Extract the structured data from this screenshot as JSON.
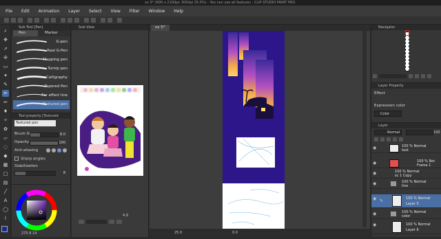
{
  "window": {
    "title": "xx 5* (600 x 2100px 300dpi 25.0%)  - You can use all features - CLIP STUDIO PAINT PRO"
  },
  "menu": {
    "items": [
      "File",
      "Edit",
      "Animation",
      "Layer",
      "Select",
      "View",
      "Filter",
      "Window",
      "Help"
    ]
  },
  "subtool": {
    "panel_title": "Sub Tool [Pen]",
    "tabs": [
      "Pen",
      "Marker"
    ],
    "brushes": [
      {
        "name": "G-pen"
      },
      {
        "name": "Real G-Pen"
      },
      {
        "name": "Mapping pen"
      },
      {
        "name": "Turnip pen"
      },
      {
        "name": "Calligraphy"
      },
      {
        "name": "Tapered Pen"
      },
      {
        "name": "For effect line"
      },
      {
        "name": "Textured pen"
      }
    ],
    "selected": "Textured pen"
  },
  "toolprop": {
    "panel_title": "Tool property [Textured",
    "preset_name": "Textured pen",
    "brush_size": {
      "label": "Brush Size",
      "value": "8.0",
      "fraction": 0.35
    },
    "opacity": {
      "label": "Opacity",
      "value": "100",
      "fraction": 1.0
    },
    "anti_aliasing": {
      "label": "Anti-aliasing"
    },
    "sharp_angles": {
      "label": "Sharp angles"
    },
    "stabilization": {
      "label": "Stabilization",
      "value": "8",
      "fraction": 0.25
    }
  },
  "color": {
    "main": "#1a2a8a",
    "sub": "#ffffff",
    "readout": "275  8  14"
  },
  "subview": {
    "panel_title": "Sub View"
  },
  "canvas": {
    "tab_label": "xx 5*",
    "zoom": "25.0",
    "angle": "0.0",
    "status_left": "4.9"
  },
  "navigator": {
    "panel_title": "Navigator"
  },
  "layerprop": {
    "panel_title": "Layer Property",
    "effect_label": "Effect",
    "expression_label": "Expression color",
    "expression_value": "Color"
  },
  "layers": {
    "panel_title": "Layer",
    "blend_mode": "Normal",
    "opacity": "100",
    "items": [
      {
        "line1": "100 % Normal",
        "line2": "text"
      },
      {
        "line1": "100 % Nor",
        "line2": "Frame 1"
      },
      {
        "line1": "100 % Normal",
        "line2": "sc 1 Copy"
      },
      {
        "line1": "100 % Normal",
        "line2": "line"
      },
      {
        "line1": "100 % Normal",
        "line2": "Layer 5"
      },
      {
        "line1": "100 % Normal",
        "line2": "color"
      },
      {
        "line1": "100 % Normal",
        "line2": "Layer 6"
      }
    ],
    "selected_index": 4
  }
}
